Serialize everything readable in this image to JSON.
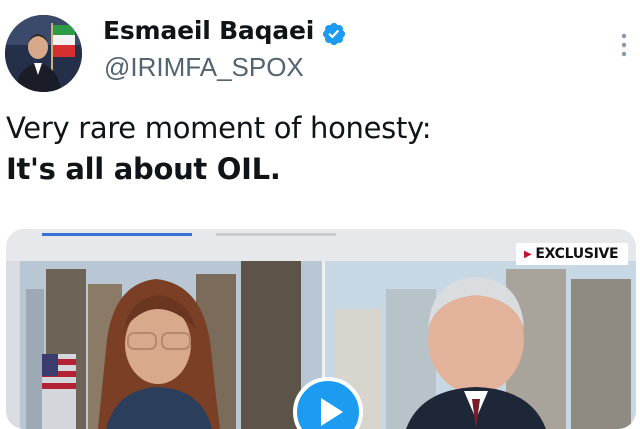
{
  "author": {
    "display_name": "Esmaeil Baqaei",
    "handle": "@IRIMFA_SPOX",
    "verified_icon": "verified-badge-icon",
    "accent_color": "#1d9bf0"
  },
  "tweet": {
    "line1": "Very rare moment of honesty:",
    "line2": "It's all about OIL."
  },
  "media": {
    "badge_label": "EXCLUSIVE",
    "play_icon": "play-icon"
  },
  "menu_icon": "more-options-icon"
}
